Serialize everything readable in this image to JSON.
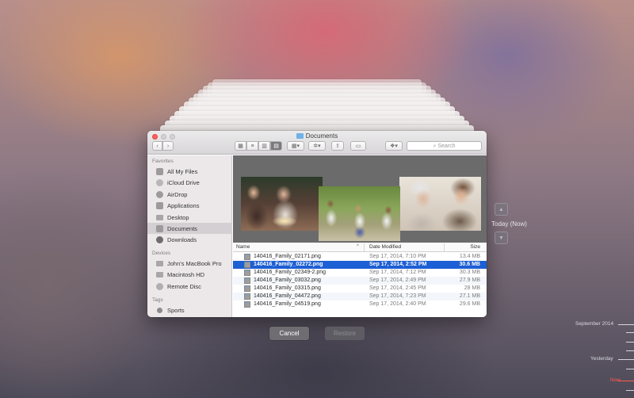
{
  "window": {
    "title": "Documents"
  },
  "toolbar": {
    "back_icon": "chevron-left-icon",
    "forward_icon": "chevron-right-icon",
    "view_icons": [
      "icon-view-icon",
      "list-view-icon",
      "column-view-icon",
      "cover-flow-icon"
    ],
    "arrange_icon": "arrange-grid-icon",
    "action_icon": "gear-icon",
    "share_icon": "share-icon",
    "tag_icon": "tag-icon",
    "dropbox_icon": "dropbox-icon",
    "search_placeholder": "Search"
  },
  "sidebar": {
    "sections": [
      {
        "heading": "Favorites",
        "items": [
          {
            "label": "All My Files",
            "icon": "all-files-icon"
          },
          {
            "label": "iCloud Drive",
            "icon": "cloud-icon"
          },
          {
            "label": "AirDrop",
            "icon": "airdrop-icon"
          },
          {
            "label": "Applications",
            "icon": "applications-icon"
          },
          {
            "label": "Desktop",
            "icon": "desktop-icon"
          },
          {
            "label": "Documents",
            "icon": "documents-icon",
            "selected": true
          },
          {
            "label": "Downloads",
            "icon": "downloads-icon"
          }
        ]
      },
      {
        "heading": "Devices",
        "items": [
          {
            "label": "John's MacBook Pro",
            "icon": "laptop-icon"
          },
          {
            "label": "Macintosh HD",
            "icon": "hard-drive-icon"
          },
          {
            "label": "Remote Disc",
            "icon": "disc-icon"
          }
        ]
      },
      {
        "heading": "Tags",
        "items": [
          {
            "label": "Sports",
            "icon": "tag-dot-icon"
          }
        ]
      }
    ]
  },
  "list": {
    "columns": {
      "name": "Name",
      "date": "Date Modified",
      "size": "Size"
    },
    "rows": [
      {
        "name": "140416_Family_02171.png",
        "date": "Sep 17, 2014, 7:10 PM",
        "size": "13.4 MB",
        "selected": false
      },
      {
        "name": "140416_Family_02272.png",
        "date": "Sep 17, 2014, 2:52 PM",
        "size": "30.6 MB",
        "selected": true
      },
      {
        "name": "140416_Family_02349-2.png",
        "date": "Sep 17, 2014, 7:12 PM",
        "size": "30.3 MB",
        "selected": false
      },
      {
        "name": "140416_Family_03032.png",
        "date": "Sep 17, 2014, 2:49 PM",
        "size": "27.9 MB",
        "selected": false
      },
      {
        "name": "140416_Family_03315.png",
        "date": "Sep 17, 2014, 2:45 PM",
        "size": "28 MB",
        "selected": false
      },
      {
        "name": "140416_Family_04472.png",
        "date": "Sep 17, 2014, 7:23 PM",
        "size": "27.1 MB",
        "selected": false
      },
      {
        "name": "140416_Family_04519.png",
        "date": "Sep 17, 2014, 2:40 PM",
        "size": "29.6 MB",
        "selected": false
      }
    ]
  },
  "buttons": {
    "cancel": "Cancel",
    "restore": "Restore"
  },
  "time_machine": {
    "current_label": "Today (Now)",
    "timeline": [
      {
        "label": "September 2014"
      },
      {
        "label": "Yesterday"
      },
      {
        "label": "Now"
      }
    ],
    "up_icon": "chevron-up-icon",
    "down_icon": "chevron-down-icon"
  },
  "colors": {
    "selection": "#1d5fd4",
    "now_marker": "#ff5b4f",
    "close_button": "#fc605c"
  }
}
